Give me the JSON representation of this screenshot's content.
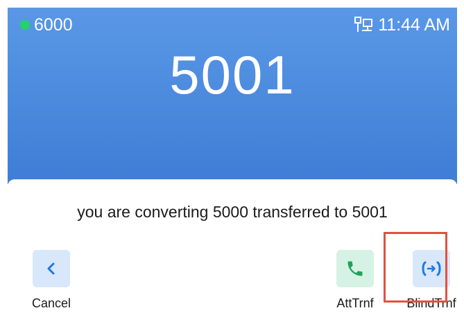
{
  "status_bar": {
    "account": "6000",
    "account_status_color": "#22d36b",
    "network_icon": "network-icon",
    "time": "11:44 AM"
  },
  "call": {
    "number": "5001"
  },
  "dialog": {
    "message": "you are converting 5000 transferred to 5001"
  },
  "actions": {
    "cancel": {
      "label": "Cancel",
      "icon": "chevron-left-icon"
    },
    "att_transfer": {
      "label": "AttTrnf",
      "icon": "phone-icon"
    },
    "blind_transfer": {
      "label": "BlindTrnf",
      "icon": "blind-transfer-icon"
    }
  },
  "colors": {
    "header": "#4a89de",
    "accent_blue": "#1e78e6",
    "accent_green": "#1fa35c",
    "highlight": "#e3503f"
  }
}
